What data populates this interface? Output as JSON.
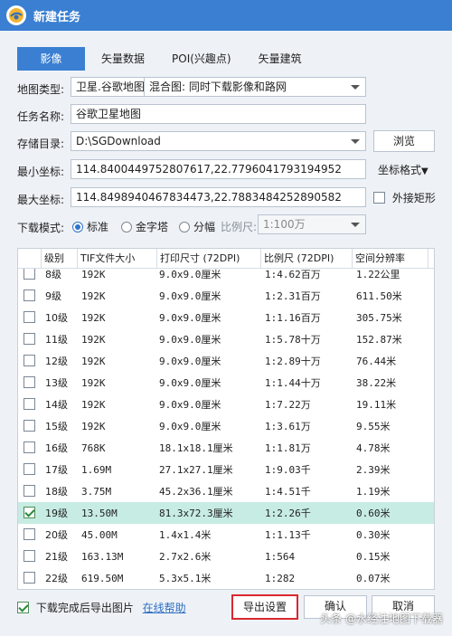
{
  "window": {
    "title": "新建任务"
  },
  "tabs": [
    {
      "label": "影像",
      "active": true
    },
    {
      "label": "矢量数据",
      "active": false
    },
    {
      "label": "POI(兴趣点)",
      "active": false
    },
    {
      "label": "矢量建筑",
      "active": false
    }
  ],
  "form": {
    "map_type_label": "地图类型:",
    "map_type_value": "卫星.谷歌地图",
    "mix_value": "混合图: 同时下载影像和路网",
    "task_name_label": "任务名称:",
    "task_name_value": "谷歌卫星地图",
    "storage_label": "存储目录:",
    "storage_value": "D:\\SGDownload",
    "browse_label": "浏览",
    "min_coord_label": "最小坐标:",
    "min_coord_value": "114.8400449752807617,22.7796041793194952",
    "coord_format_label": "坐标格式",
    "max_coord_label": "最大坐标:",
    "max_coord_value": "114.8498940467834473,22.7883484252890582",
    "outer_rect_label": "外接矩形",
    "download_mode_label": "下载模式:",
    "mode_standard": "标准",
    "mode_pyramid": "金字塔",
    "mode_split": "分幅",
    "scale_label": "比例尺:",
    "scale_value": "1:100万"
  },
  "table": {
    "headers": [
      "级别",
      "TIF文件大小",
      "打印尺寸 (72DPI)",
      "比例尺 (72DPI)",
      "空间分辨率"
    ],
    "rows": [
      {
        "level": "8级",
        "size": "192K",
        "print": "9.0x9.0厘米",
        "scale": "1:4.62百万",
        "res": "1.22公里",
        "checked": false,
        "selected": false
      },
      {
        "level": "9级",
        "size": "192K",
        "print": "9.0x9.0厘米",
        "scale": "1:2.31百万",
        "res": "611.50米",
        "checked": false,
        "selected": false
      },
      {
        "level": "10级",
        "size": "192K",
        "print": "9.0x9.0厘米",
        "scale": "1:1.16百万",
        "res": "305.75米",
        "checked": false,
        "selected": false
      },
      {
        "level": "11级",
        "size": "192K",
        "print": "9.0x9.0厘米",
        "scale": "1:5.78十万",
        "res": "152.87米",
        "checked": false,
        "selected": false
      },
      {
        "level": "12级",
        "size": "192K",
        "print": "9.0x9.0厘米",
        "scale": "1:2.89十万",
        "res": "76.44米",
        "checked": false,
        "selected": false
      },
      {
        "level": "13级",
        "size": "192K",
        "print": "9.0x9.0厘米",
        "scale": "1:1.44十万",
        "res": "38.22米",
        "checked": false,
        "selected": false
      },
      {
        "level": "14级",
        "size": "192K",
        "print": "9.0x9.0厘米",
        "scale": "1:7.22万",
        "res": "19.11米",
        "checked": false,
        "selected": false
      },
      {
        "level": "15级",
        "size": "192K",
        "print": "9.0x9.0厘米",
        "scale": "1:3.61万",
        "res": "9.55米",
        "checked": false,
        "selected": false
      },
      {
        "level": "16级",
        "size": "768K",
        "print": "18.1x18.1厘米",
        "scale": "1:1.81万",
        "res": "4.78米",
        "checked": false,
        "selected": false
      },
      {
        "level": "17级",
        "size": "1.69M",
        "print": "27.1x27.1厘米",
        "scale": "1:9.03千",
        "res": "2.39米",
        "checked": false,
        "selected": false
      },
      {
        "level": "18级",
        "size": "3.75M",
        "print": "45.2x36.1厘米",
        "scale": "1:4.51千",
        "res": "1.19米",
        "checked": false,
        "selected": false
      },
      {
        "level": "19级",
        "size": "13.50M",
        "print": "81.3x72.3厘米",
        "scale": "1:2.26千",
        "res": "0.60米",
        "checked": true,
        "selected": true
      },
      {
        "level": "20级",
        "size": "45.00M",
        "print": "1.4x1.4米",
        "scale": "1:1.13千",
        "res": "0.30米",
        "checked": false,
        "selected": false
      },
      {
        "level": "21级",
        "size": "163.13M",
        "print": "2.7x2.6米",
        "scale": "1:564",
        "res": "0.15米",
        "checked": false,
        "selected": false
      },
      {
        "level": "22级",
        "size": "619.50M",
        "print": "5.3x5.1米",
        "scale": "1:282",
        "res": "0.07米",
        "checked": false,
        "selected": false
      }
    ]
  },
  "footer": {
    "export_after_label": "下载完成后导出图片",
    "help_link": "在线帮助",
    "export_settings_label": "导出设置",
    "ok_label": "确认",
    "cancel_label": "取消"
  },
  "watermark": "头条 @水经注地图下载器",
  "colors": {
    "titlebar": "#3a7fd2",
    "tab_active": "#3a7fd2",
    "selected_row": "#c7ece3",
    "highlight_border": "#d9282f"
  }
}
